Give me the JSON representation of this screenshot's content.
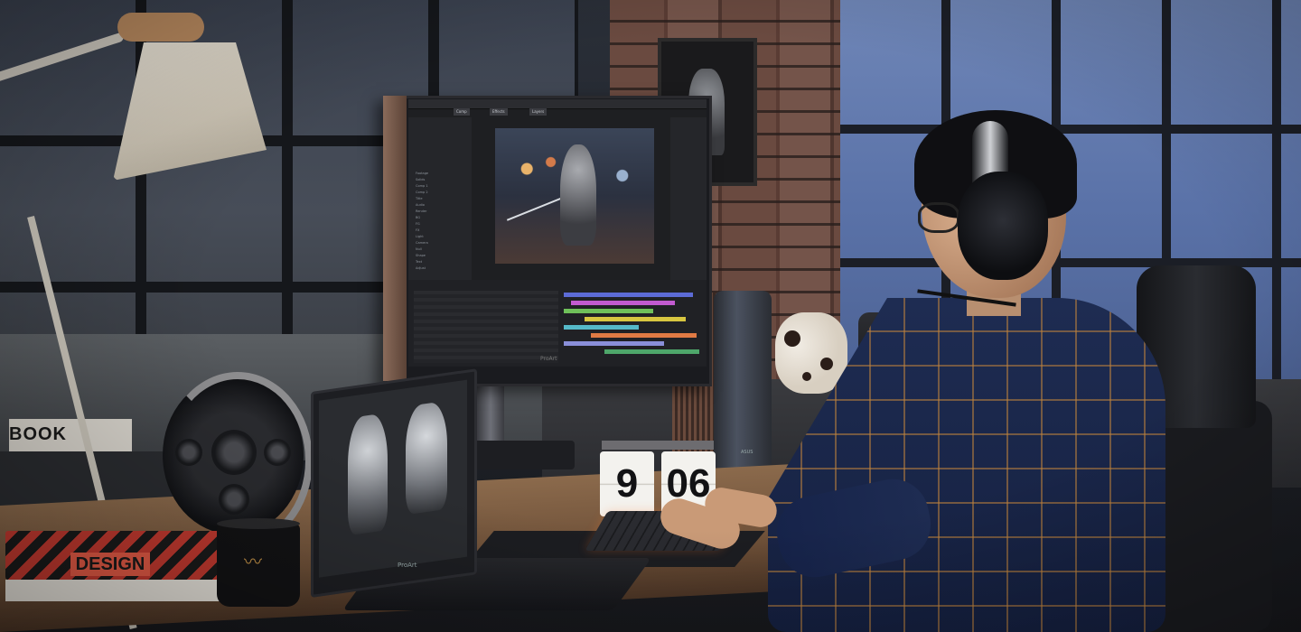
{
  "scene": {
    "book_title": "DESIGN",
    "left_book_text": "BOOK",
    "clock_digits": [
      "9",
      "06"
    ],
    "monitor_brand": "ProArt",
    "laptop_brand": "ProArt",
    "pc_brand": "ASUS",
    "editor_tabs": [
      "Comp",
      "Effects",
      "Layers"
    ],
    "project_rows": [
      "Footage",
      "Solids",
      "Comp 1",
      "Comp 2",
      "Title",
      "Audio",
      "Render",
      "BG",
      "FG",
      "FX",
      "Light",
      "Camera",
      "Null",
      "Shape",
      "Text",
      "Adjust"
    ]
  },
  "colors": {
    "accent_orange": "#c2392f",
    "window_blue": "#5a72a8",
    "desk_wood": "#8b6a4c"
  },
  "timeline_tracks": [
    {
      "color": "#5c6bd6",
      "start": 0.0,
      "end": 0.95
    },
    {
      "color": "#c25bd0",
      "start": 0.05,
      "end": 0.82
    },
    {
      "color": "#6fc05a",
      "start": 0.0,
      "end": 0.66
    },
    {
      "color": "#d7c640",
      "start": 0.15,
      "end": 0.9
    },
    {
      "color": "#55b9c9",
      "start": 0.0,
      "end": 0.55
    },
    {
      "color": "#e07a44",
      "start": 0.2,
      "end": 0.98
    },
    {
      "color": "#8a8fd9",
      "start": 0.0,
      "end": 0.74
    },
    {
      "color": "#4ea66a",
      "start": 0.3,
      "end": 1.0
    }
  ]
}
